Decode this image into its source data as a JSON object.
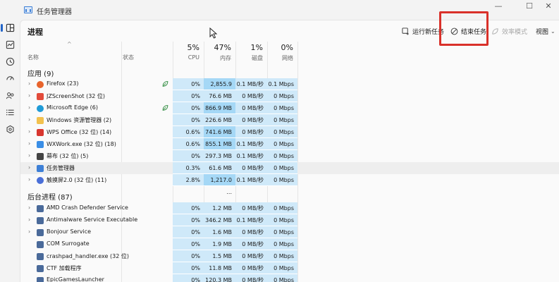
{
  "window": {
    "title": "任务管理器",
    "minimize_glyph": "—",
    "maximize_glyph": "☐",
    "close_glyph": "✕"
  },
  "nav_icons": [
    "processes-icon",
    "performance-icon",
    "app-history-icon",
    "startup-icon",
    "users-icon",
    "details-icon",
    "services-icon"
  ],
  "page": {
    "title": "进程"
  },
  "toolbar": {
    "run_new_task": "运行新任务",
    "end_task": "结束任务",
    "efficiency_mode": "效率模式",
    "view": "视图",
    "view_chevron": "⌄"
  },
  "columns": {
    "sort_arrow": "^",
    "name": "名称",
    "status": "状态",
    "cpu": {
      "pct": "5%",
      "label": "CPU"
    },
    "mem": {
      "pct": "47%",
      "label": "内存"
    },
    "disk": {
      "pct": "1%",
      "label": "磁盘"
    },
    "net": {
      "pct": "0%",
      "label": "网络"
    }
  },
  "groups": {
    "apps": {
      "title": "应用 (9)"
    },
    "background": {
      "title": "后台进程 (87)"
    }
  },
  "apps": [
    {
      "name": "Firefox (23)",
      "icon": "firefox-icon",
      "color": "#e8642c",
      "leaf": true,
      "cpu": "0%",
      "mem": "2,855.9 MB",
      "disk": "0.1 MB/秒",
      "net": "0.1 Mbps",
      "mem_heat": 2
    },
    {
      "name": "JZScreenShot (32 位)",
      "icon": "screenshot-icon",
      "color": "#e24b3b",
      "leaf": false,
      "cpu": "0%",
      "mem": "76.6 MB",
      "disk": "0 MB/秒",
      "net": "0 Mbps",
      "mem_heat": 1
    },
    {
      "name": "Microsoft Edge (6)",
      "icon": "edge-icon",
      "color": "#1f9bd7",
      "leaf": true,
      "cpu": "0%",
      "mem": "866.9 MB",
      "disk": "0 MB/秒",
      "net": "0 Mbps",
      "mem_heat": 2
    },
    {
      "name": "Windows 资源管理器 (2)",
      "icon": "explorer-icon",
      "color": "#f2c14e",
      "leaf": false,
      "cpu": "0%",
      "mem": "226.6 MB",
      "disk": "0 MB/秒",
      "net": "0 Mbps",
      "mem_heat": 1
    },
    {
      "name": "WPS Office (32 位) (14)",
      "icon": "wps-icon",
      "color": "#d8362f",
      "leaf": false,
      "cpu": "0.6%",
      "mem": "741.6 MB",
      "disk": "0 MB/秒",
      "net": "0 Mbps",
      "mem_heat": 2
    },
    {
      "name": "WXWork.exe (32 位) (18)",
      "icon": "wxwork-icon",
      "color": "#3a8ee6",
      "leaf": false,
      "cpu": "0.6%",
      "mem": "855.1 MB",
      "disk": "0.1 MB/秒",
      "net": "0 Mbps",
      "mem_heat": 2
    },
    {
      "name": "幕布 (32 位) (5)",
      "icon": "mubu-icon",
      "color": "#444444",
      "leaf": false,
      "cpu": "0%",
      "mem": "297.3 MB",
      "disk": "0.1 MB/秒",
      "net": "0 Mbps",
      "mem_heat": 1
    },
    {
      "name": "任务管理器",
      "icon": "task-manager-icon",
      "color": "#3d7fd6",
      "leaf": false,
      "cpu": "0.3%",
      "mem": "61.6 MB",
      "disk": "0 MB/秒",
      "net": "0 Mbps",
      "mem_heat": 1
    },
    {
      "name": "触摸屏2.0 (32 位) (11)",
      "icon": "touch-icon",
      "color": "#4a6fd8",
      "leaf": false,
      "cpu": "2.8%",
      "mem": "1,217.0 ...",
      "disk": "0.1 MB/秒",
      "net": "0 Mbps",
      "mem_heat": 2
    }
  ],
  "background": [
    {
      "name": "AMD Crash Defender Service",
      "icon": "service-icon",
      "color": "#4a6a9a",
      "expand": true,
      "cpu": "0%",
      "mem": "1.2 MB",
      "disk": "0 MB/秒",
      "net": "0 Mbps"
    },
    {
      "name": "Antimalware Service Executable",
      "icon": "service-icon",
      "color": "#4a6a9a",
      "expand": true,
      "cpu": "0%",
      "mem": "346.2 MB",
      "disk": "0.1 MB/秒",
      "net": "0 Mbps"
    },
    {
      "name": "Bonjour Service",
      "icon": "service-icon",
      "color": "#4a6a9a",
      "expand": true,
      "cpu": "0%",
      "mem": "1.6 MB",
      "disk": "0 MB/秒",
      "net": "0 Mbps"
    },
    {
      "name": "COM Surrogate",
      "icon": "process-icon",
      "color": "#4a6a9a",
      "expand": false,
      "cpu": "0%",
      "mem": "1.9 MB",
      "disk": "0 MB/秒",
      "net": "0 Mbps"
    },
    {
      "name": "crashpad_handler.exe (32 位)",
      "icon": "process-icon",
      "color": "#4a6a9a",
      "expand": false,
      "cpu": "0%",
      "mem": "1.5 MB",
      "disk": "0 MB/秒",
      "net": "0 Mbps"
    },
    {
      "name": "CTF 加载程序",
      "icon": "ctf-icon",
      "color": "#4a6a9a",
      "expand": false,
      "cpu": "0%",
      "mem": "11.8 MB",
      "disk": "0 MB/秒",
      "net": "0 Mbps"
    },
    {
      "name": "EpicGamesLauncher",
      "icon": "process-icon",
      "color": "#4a6a9a",
      "expand": false,
      "cpu": "0%",
      "mem": "120.3 MB",
      "disk": "0 MB/秒",
      "net": "0 Mbps"
    }
  ]
}
